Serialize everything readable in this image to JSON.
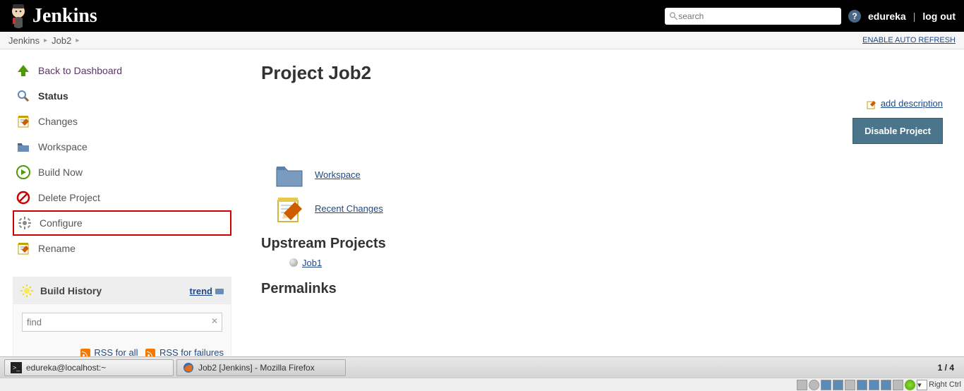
{
  "header": {
    "logo_text": "Jenkins",
    "search_placeholder": "search",
    "user": "edureka",
    "logout": "log out"
  },
  "breadcrumb": {
    "root": "Jenkins",
    "job": "Job2",
    "auto_refresh": "ENABLE AUTO REFRESH"
  },
  "sidebar": {
    "dashboard": "Back to Dashboard",
    "status": "Status",
    "changes": "Changes",
    "workspace": "Workspace",
    "build_now": "Build Now",
    "delete": "Delete Project",
    "configure": "Configure",
    "rename": "Rename"
  },
  "build_history": {
    "title": "Build History",
    "trend": "trend",
    "find_placeholder": "find",
    "rss_all": "RSS for all",
    "rss_fail": "RSS for failures"
  },
  "content": {
    "title": "Project Job2",
    "add_description": "add description",
    "disable_btn": "Disable Project",
    "workspace_link": "Workspace",
    "recent_changes": "Recent Changes",
    "upstream_heading": "Upstream Projects",
    "upstream_job": "Job1",
    "permalinks_heading": "Permalinks"
  },
  "taskbar": {
    "terminal": "edureka@localhost:~",
    "browser": "Job2 [Jenkins] - Mozilla Firefox",
    "pager": "1 / 4"
  },
  "status_strip": {
    "label": "Right Ctrl"
  }
}
